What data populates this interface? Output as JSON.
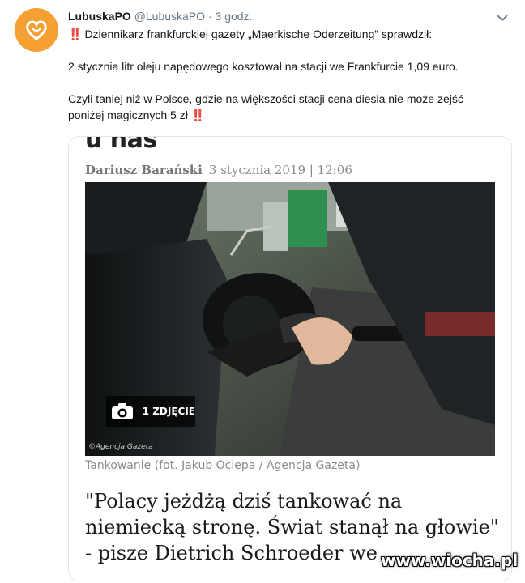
{
  "tweet": {
    "author_name": "LubuskaPO",
    "handle": "@LubuskaPO",
    "separator": "·",
    "time": "3 godz.",
    "emoji": "‼️",
    "line1": "Dziennikarz frankfurckiej gazety „Maerkische Oderzeitung” sprawdził:",
    "line2": "2 stycznia litr oleju napędowego kosztował na stacji we Frankfurcie 1,09 euro.",
    "line3": "Czyli taniej niż w Polsce, gdzie na większości stacji cena diesla nie może zejść",
    "line4": "poniżej magicznych 5 zł",
    "avatar_color": "#f5a033",
    "menu_icon": "chevron-down-icon"
  },
  "card": {
    "cut_title": "u nas",
    "author": "Dariusz Barański",
    "date": "3 stycznia 2019 | 12:06",
    "photo_badge": "1 ZDJĘCIE",
    "photo_credit": "©Agencja Gazeta",
    "caption": "Tankowanie (fot. Jakub Ociepa / Agencja Gazeta)",
    "headline_line1": "\"Polacy jeżdżą dziś tankować na",
    "headline_line2": "niemiecką stronę. Świat stanął na głowie\"",
    "headline_line3": "- pisze Dietrich Schroeder we"
  },
  "watermark": "www.wiocha.pl"
}
